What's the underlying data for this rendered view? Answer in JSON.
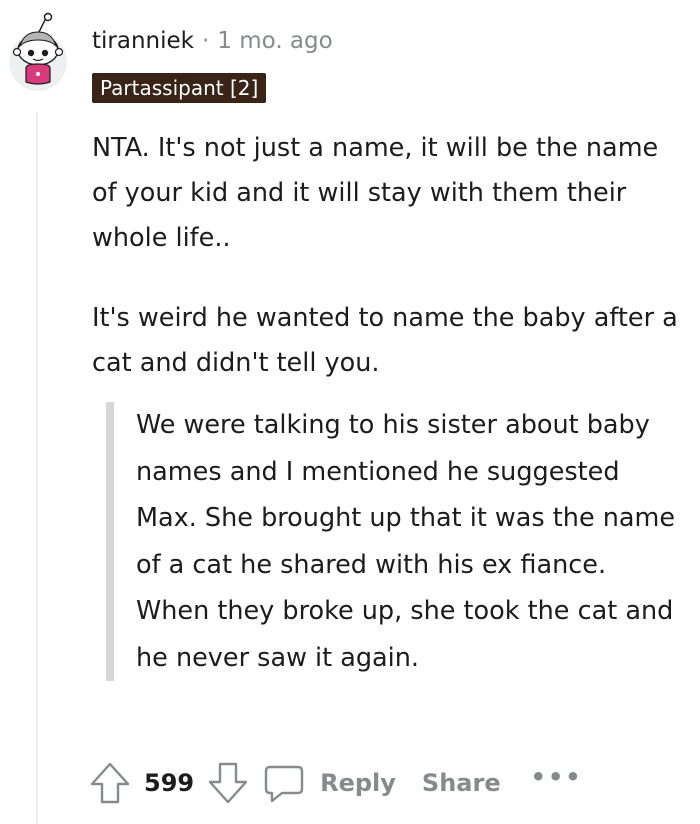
{
  "comment": {
    "username": "tiranniek",
    "separator": "·",
    "timestamp": "1 mo. ago",
    "flair": "Partassipant [2]",
    "paragraphs": [
      "NTA. It's not just a name, it will be the name of your kid and it will stay with them their whole life..",
      "It's weird he wanted to name the baby after a cat and didn't tell you."
    ],
    "quote": "We were talking to his sister about baby names and I mentioned he suggested Max. She brought up that it was the name of a cat he shared with his ex fiance. When they broke up, she took the cat and he never saw it again."
  },
  "actions": {
    "upvote_icon": "upvote-arrow-icon",
    "vote_count": "599",
    "downvote_icon": "downvote-arrow-icon",
    "reply_icon": "speech-bubble-icon",
    "reply_label": "Reply",
    "share_label": "Share",
    "more_label": "•••"
  },
  "colors": {
    "flair_bg": "#3a2317",
    "meta_gray": "#878a8c",
    "quote_bar": "#d7d7d7",
    "avatar_shirt": "#d93a7d"
  }
}
